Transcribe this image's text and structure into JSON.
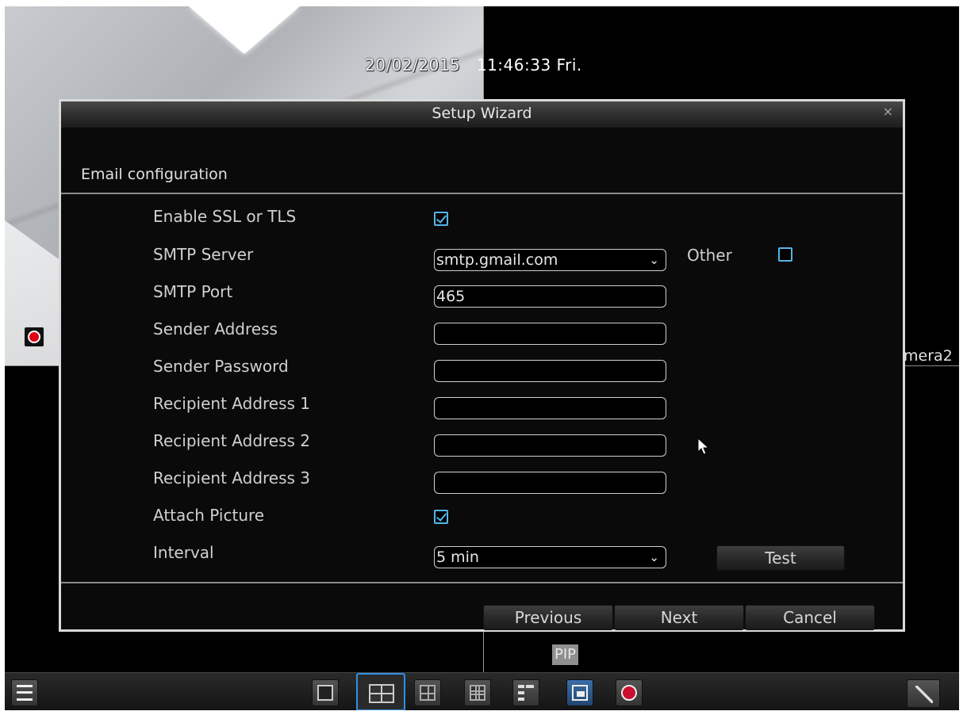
{
  "overlay": {
    "date": "20/02/2015",
    "time": "11:46:33 Fri.",
    "camera2_label": "mera2",
    "pip_label": "PIP"
  },
  "dialog": {
    "title": "Setup Wizard",
    "close_glyph": "×",
    "section_title": "Email configuration"
  },
  "form": {
    "enable_ssl_label": "Enable SSL or TLS",
    "enable_ssl_checked": true,
    "smtp_server_label": "SMTP Server",
    "smtp_server_value": "smtp.gmail.com",
    "other_label": "Other",
    "other_checked": false,
    "smtp_port_label": "SMTP Port",
    "smtp_port_value": "465",
    "sender_address_label": "Sender Address",
    "sender_address_value": "",
    "sender_password_label": "Sender Password",
    "sender_password_value": "",
    "recipient1_label": "Recipient Address 1",
    "recipient1_value": "",
    "recipient2_label": "Recipient Address 2",
    "recipient2_value": "",
    "recipient3_label": "Recipient Address 3",
    "recipient3_value": "",
    "attach_picture_label": "Attach Picture",
    "attach_picture_checked": true,
    "interval_label": "Interval",
    "interval_value": "5 min",
    "test_label": "Test"
  },
  "footer": {
    "previous_label": "Previous",
    "next_label": "Next",
    "cancel_label": "Cancel"
  },
  "chevron_glyph": "⌄",
  "colors": {
    "accent": "#55b6e8",
    "selected_layout": "#2f8fe6",
    "record_red": "#e00010"
  },
  "taskbar": {
    "icons": [
      "menu-icon",
      "layout-1-icon",
      "layout-4-icon",
      "layout-6-icon",
      "layout-9-icon",
      "sequence-icon",
      "pip-icon",
      "record-icon",
      "wizard-icon"
    ]
  }
}
